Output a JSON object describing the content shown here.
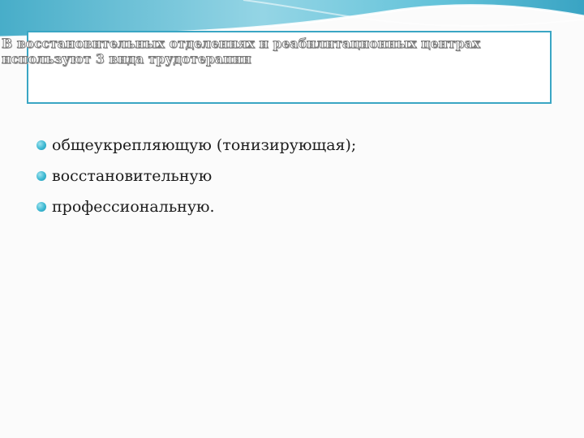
{
  "slide": {
    "title": "В восстановительных отделениях и реабилитационных центрах используют 3 вида трудотерапии",
    "bullets": [
      "общеукрепляющую (тонизирующая);",
      "восстановительную",
      "профессиональную."
    ]
  },
  "colors": {
    "accent": "#3aa6c4",
    "bullet": "#3cb8d2",
    "background": "#fbfbfb"
  }
}
